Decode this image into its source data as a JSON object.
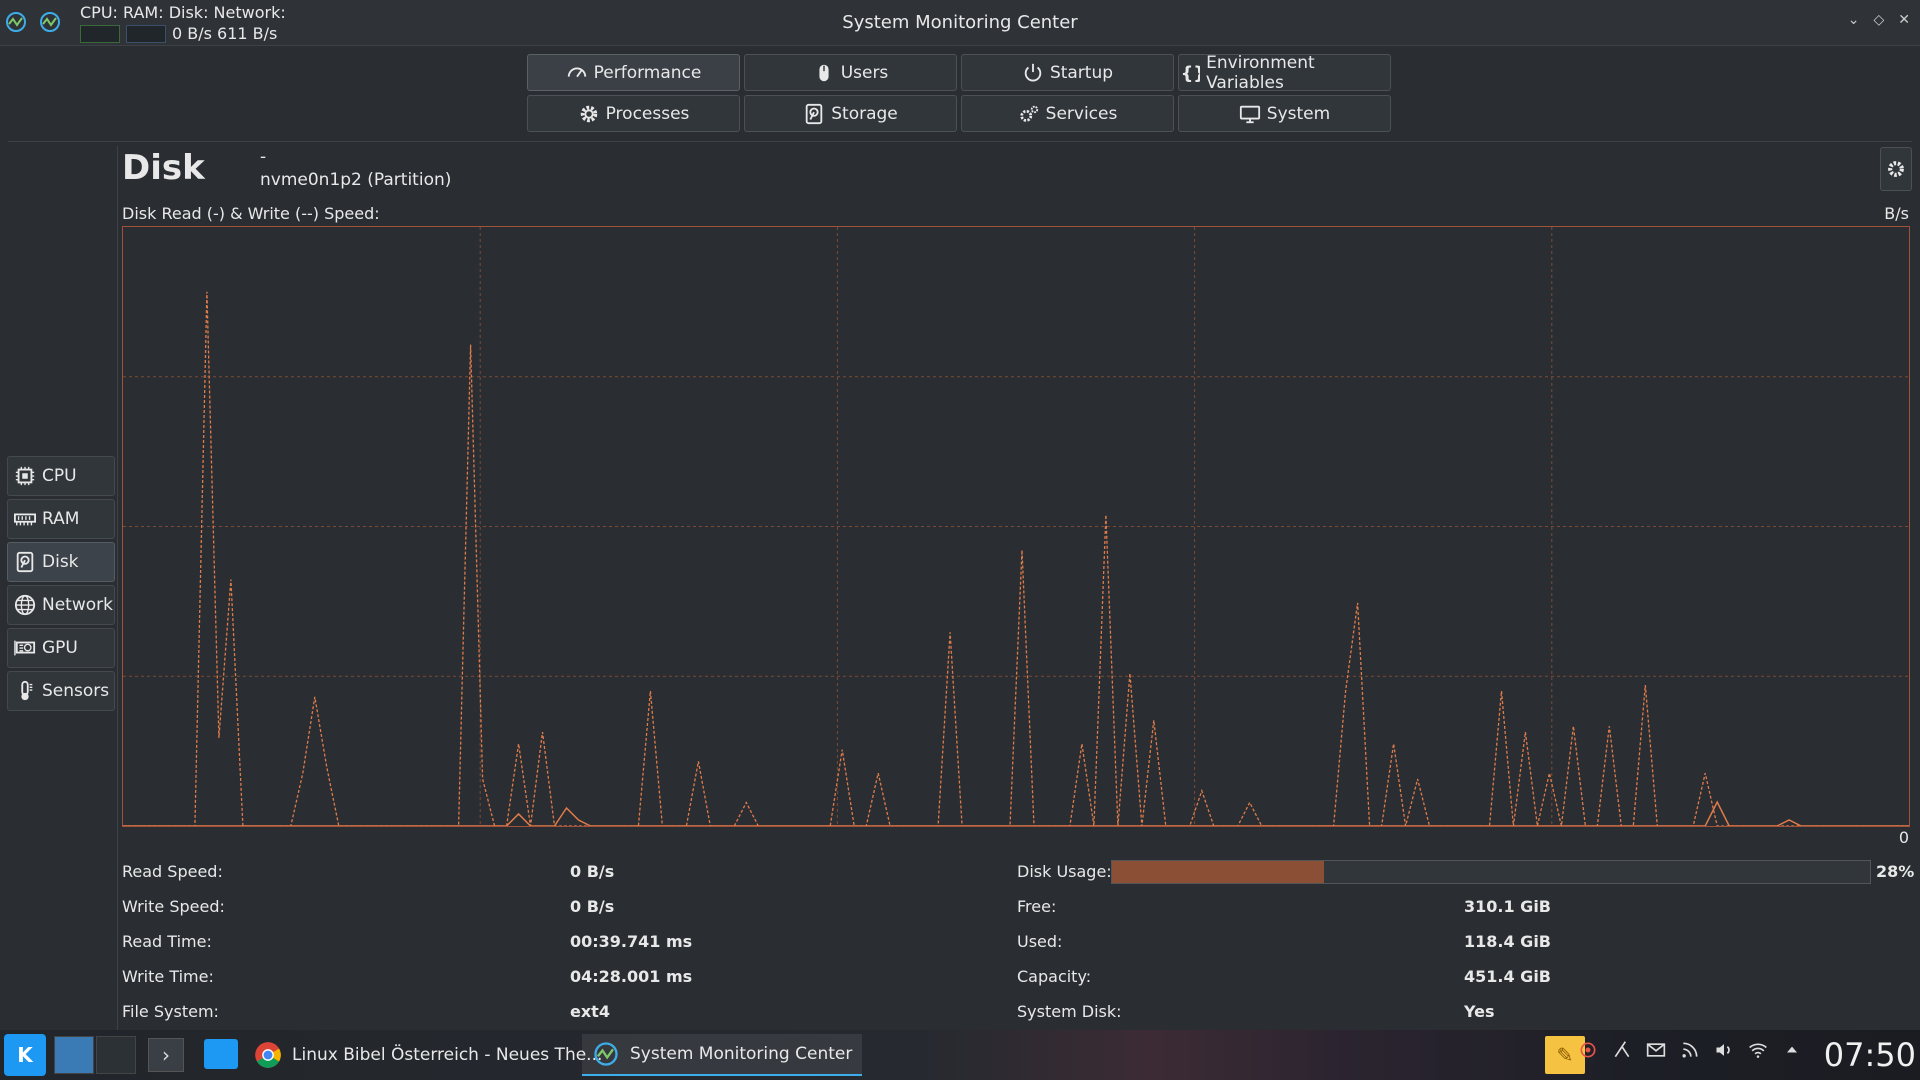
{
  "titlebar": {
    "title": "System Monitoring Center",
    "mini_labels": "CPU: RAM: Disk: Network:",
    "mini_values": "0 B/s 611 B/s"
  },
  "tabs": [
    {
      "label": "Performance",
      "icon": "gauge-icon"
    },
    {
      "label": "Users",
      "icon": "mouse-icon"
    },
    {
      "label": "Startup",
      "icon": "power-icon"
    },
    {
      "label": "Environment Variables",
      "icon": "braces-icon"
    },
    {
      "label": "Processes",
      "icon": "gear-icon"
    },
    {
      "label": "Storage",
      "icon": "disk-icon"
    },
    {
      "label": "Services",
      "icon": "gears-icon"
    },
    {
      "label": "System",
      "icon": "monitor-icon"
    }
  ],
  "sidebar": {
    "items": [
      {
        "label": "CPU",
        "icon": "cpu-icon"
      },
      {
        "label": "RAM",
        "icon": "ram-icon"
      },
      {
        "label": "Disk",
        "icon": "disk-icon"
      },
      {
        "label": "Network",
        "icon": "globe-icon"
      },
      {
        "label": "GPU",
        "icon": "gpu-icon"
      },
      {
        "label": "Sensors",
        "icon": "thermometer-icon"
      }
    ],
    "active": "Disk"
  },
  "header": {
    "title": "Disk",
    "model": "-",
    "device": "nvme0n1p2 (Partition)"
  },
  "chart": {
    "label": "Disk Read (-) & Write (--) Speed:",
    "unit": "B/s",
    "zero": "0"
  },
  "chart_data": {
    "type": "line",
    "ylim": [
      0,
      100
    ],
    "grid": true,
    "colors": {
      "read": "#e07b4a",
      "write": "#e07b4a",
      "grid": "#7a4a35"
    },
    "series": [
      {
        "values": [
          0,
          0,
          0,
          6,
          0,
          0,
          0,
          91,
          15,
          42,
          0,
          0,
          0,
          0,
          0,
          9,
          22,
          0,
          11,
          0,
          0,
          0,
          0,
          0,
          3,
          0,
          0,
          3,
          0,
          0,
          0,
          0,
          7,
          82,
          0,
          0,
          0,
          0,
          0,
          14,
          0,
          0,
          16,
          0,
          0,
          0,
          0,
          0,
          0,
          3,
          0,
          24,
          0,
          0,
          0,
          0,
          0,
          14,
          0,
          0,
          0,
          0,
          4,
          0,
          0,
          0,
          0,
          0,
          0,
          0,
          0,
          0,
          0,
          0,
          0,
          0,
          0,
          0,
          0,
          0,
          0,
          0,
          0,
          0,
          16,
          0,
          0,
          9,
          0,
          0,
          0,
          0,
          0,
          0,
          0,
          0,
          0,
          0,
          0,
          0,
          0,
          0,
          0,
          0,
          0,
          0,
          0,
          0,
          0,
          0,
          0,
          0,
          0,
          0,
          0,
          0,
          33,
          0,
          0,
          0,
          0,
          0,
          0,
          0,
          0,
          0,
          0,
          0,
          0,
          4,
          0,
          0,
          0,
          0,
          0,
          0,
          0,
          0,
          0,
          0,
          0,
          0,
          0,
          0,
          0,
          0,
          0,
          0,
          0,
          0,
          49,
          0,
          0,
          0,
          0,
          8,
          0,
          0,
          0,
          0,
          0,
          0,
          0,
          0,
          0,
          5,
          0,
          0,
          0,
          0,
          0,
          0,
          0,
          0,
          5,
          0,
          0,
          0,
          0,
          0,
          0,
          0,
          0,
          0,
          0,
          0,
          0,
          0,
          0,
          0,
          0,
          14,
          0,
          0,
          0,
          0,
          0,
          0,
          0,
          0,
          0,
          0,
          0,
          0,
          0,
          0,
          0,
          0,
          0,
          26,
          0,
          0,
          0,
          0,
          0,
          0,
          0,
          0,
          0,
          0,
          0,
          0,
          0,
          0,
          0,
          6,
          0,
          0,
          0,
          0,
          0,
          0,
          0,
          0,
          0,
          0,
          0,
          0,
          0,
          0,
          0,
          0,
          0,
          0,
          0,
          0,
          0,
          0,
          0,
          0,
          0,
          0,
          0,
          0,
          0,
          0,
          0,
          0,
          0,
          0,
          0,
          0,
          0,
          0,
          0,
          0,
          5,
          0,
          0,
          0,
          0,
          0,
          0,
          0,
          0,
          0,
          0,
          0,
          0,
          0,
          0,
          0,
          0,
          0,
          0,
          0,
          0,
          0,
          0,
          0,
          0,
          0,
          0,
          0,
          0,
          0,
          0,
          0,
          0,
          0,
          0,
          0,
          0,
          0,
          0,
          0,
          0,
          0,
          0,
          0,
          0,
          0,
          8,
          0,
          0,
          0,
          0,
          0,
          0,
          0,
          0,
          0,
          0,
          0,
          0,
          0,
          0,
          0,
          0,
          0,
          0,
          0,
          0,
          0,
          0,
          0,
          0,
          0,
          0,
          0,
          0,
          0,
          0,
          0,
          0,
          0,
          0,
          0,
          0,
          0,
          0,
          0,
          0,
          0,
          0,
          0,
          0,
          0,
          0,
          0,
          0,
          0,
          0,
          0,
          0,
          0,
          0,
          0,
          0,
          0,
          0,
          0,
          0,
          0,
          0,
          0,
          0,
          0,
          0,
          0,
          0,
          0,
          0,
          0,
          0,
          0,
          0,
          0,
          0,
          0,
          0,
          0,
          0,
          0,
          0,
          0,
          0,
          0,
          0,
          0,
          0,
          0,
          0,
          0,
          0,
          0,
          0,
          0,
          0,
          0,
          0,
          0,
          0,
          0,
          0,
          0,
          0,
          0,
          0,
          0,
          0,
          0,
          0,
          0,
          0,
          0,
          0,
          0,
          0,
          0,
          0,
          0,
          0,
          0,
          0,
          0,
          0,
          0,
          0,
          0,
          0,
          0,
          0,
          0,
          0,
          0,
          0,
          0,
          0,
          0,
          0,
          0,
          0,
          0,
          0,
          0,
          0,
          0,
          0,
          0,
          0,
          0,
          0,
          0,
          0,
          0,
          0,
          0,
          0,
          0,
          0,
          0,
          0,
          0,
          0,
          0,
          0,
          0,
          0,
          0,
          0,
          0,
          0,
          0,
          0,
          0,
          0,
          0,
          0,
          0,
          0,
          0,
          0,
          0,
          0,
          0,
          0,
          0,
          0,
          0,
          0,
          0,
          0,
          0,
          0,
          0,
          0,
          0,
          0,
          0,
          0,
          0,
          0,
          0,
          0,
          0,
          0,
          0,
          0,
          0,
          0,
          0,
          0,
          0,
          0,
          0
        ]
      }
    ],
    "peaks": [
      {
        "x": 7,
        "y": 91
      },
      {
        "x": 9,
        "y": 42
      },
      {
        "x": 8,
        "y": 15
      },
      {
        "x": 15,
        "y": 9
      },
      {
        "x": 16,
        "y": 22
      },
      {
        "x": 17,
        "y": 10
      },
      {
        "x": 29,
        "y": 82
      },
      {
        "x": 30,
        "y": 8
      },
      {
        "x": 33,
        "y": 14
      },
      {
        "x": 35,
        "y": 16
      },
      {
        "x": 44,
        "y": 23
      },
      {
        "x": 48,
        "y": 11
      },
      {
        "x": 52,
        "y": 4
      },
      {
        "x": 60,
        "y": 13
      },
      {
        "x": 63,
        "y": 9
      },
      {
        "x": 69,
        "y": 33
      },
      {
        "x": 75,
        "y": 47
      },
      {
        "x": 82,
        "y": 53
      },
      {
        "x": 84,
        "y": 26
      },
      {
        "x": 86,
        "y": 18
      },
      {
        "x": 80,
        "y": 14
      },
      {
        "x": 90,
        "y": 6
      },
      {
        "x": 94,
        "y": 4
      },
      {
        "x": 102,
        "y": 23
      },
      {
        "x": 103,
        "y": 38
      },
      {
        "x": 106,
        "y": 14
      },
      {
        "x": 108,
        "y": 8
      },
      {
        "x": 115,
        "y": 23
      },
      {
        "x": 117,
        "y": 16
      },
      {
        "x": 119,
        "y": 9
      },
      {
        "x": 121,
        "y": 17
      },
      {
        "x": 124,
        "y": 17
      },
      {
        "x": 127,
        "y": 24
      },
      {
        "x": 132,
        "y": 9
      }
    ]
  },
  "stats_left": [
    {
      "label": "Read Speed:",
      "value": "0 B/s"
    },
    {
      "label": "Write Speed:",
      "value": "0 B/s"
    },
    {
      "label": "Read Time:",
      "value": "00:39.741 ms"
    },
    {
      "label": "Write Time:",
      "value": "04:28.001 ms"
    },
    {
      "label": "File System:",
      "value": "ext4"
    }
  ],
  "stats_right": [
    {
      "label": "Free:",
      "value": "310.1 GiB"
    },
    {
      "label": "Used:",
      "value": "118.4 GiB"
    },
    {
      "label": "Capacity:",
      "value": "451.4 GiB"
    },
    {
      "label": "System Disk:",
      "value": "Yes"
    }
  ],
  "usage": {
    "label": "Disk Usage:",
    "percent": 28,
    "text": "28%"
  },
  "taskbar": {
    "tasks": [
      {
        "label": "Linux Bibel Österreich - Neues The...",
        "icon": "chrome-icon"
      },
      {
        "label": "System Monitoring Center",
        "icon": "monitor-app-icon"
      }
    ],
    "clock": "07:50"
  }
}
